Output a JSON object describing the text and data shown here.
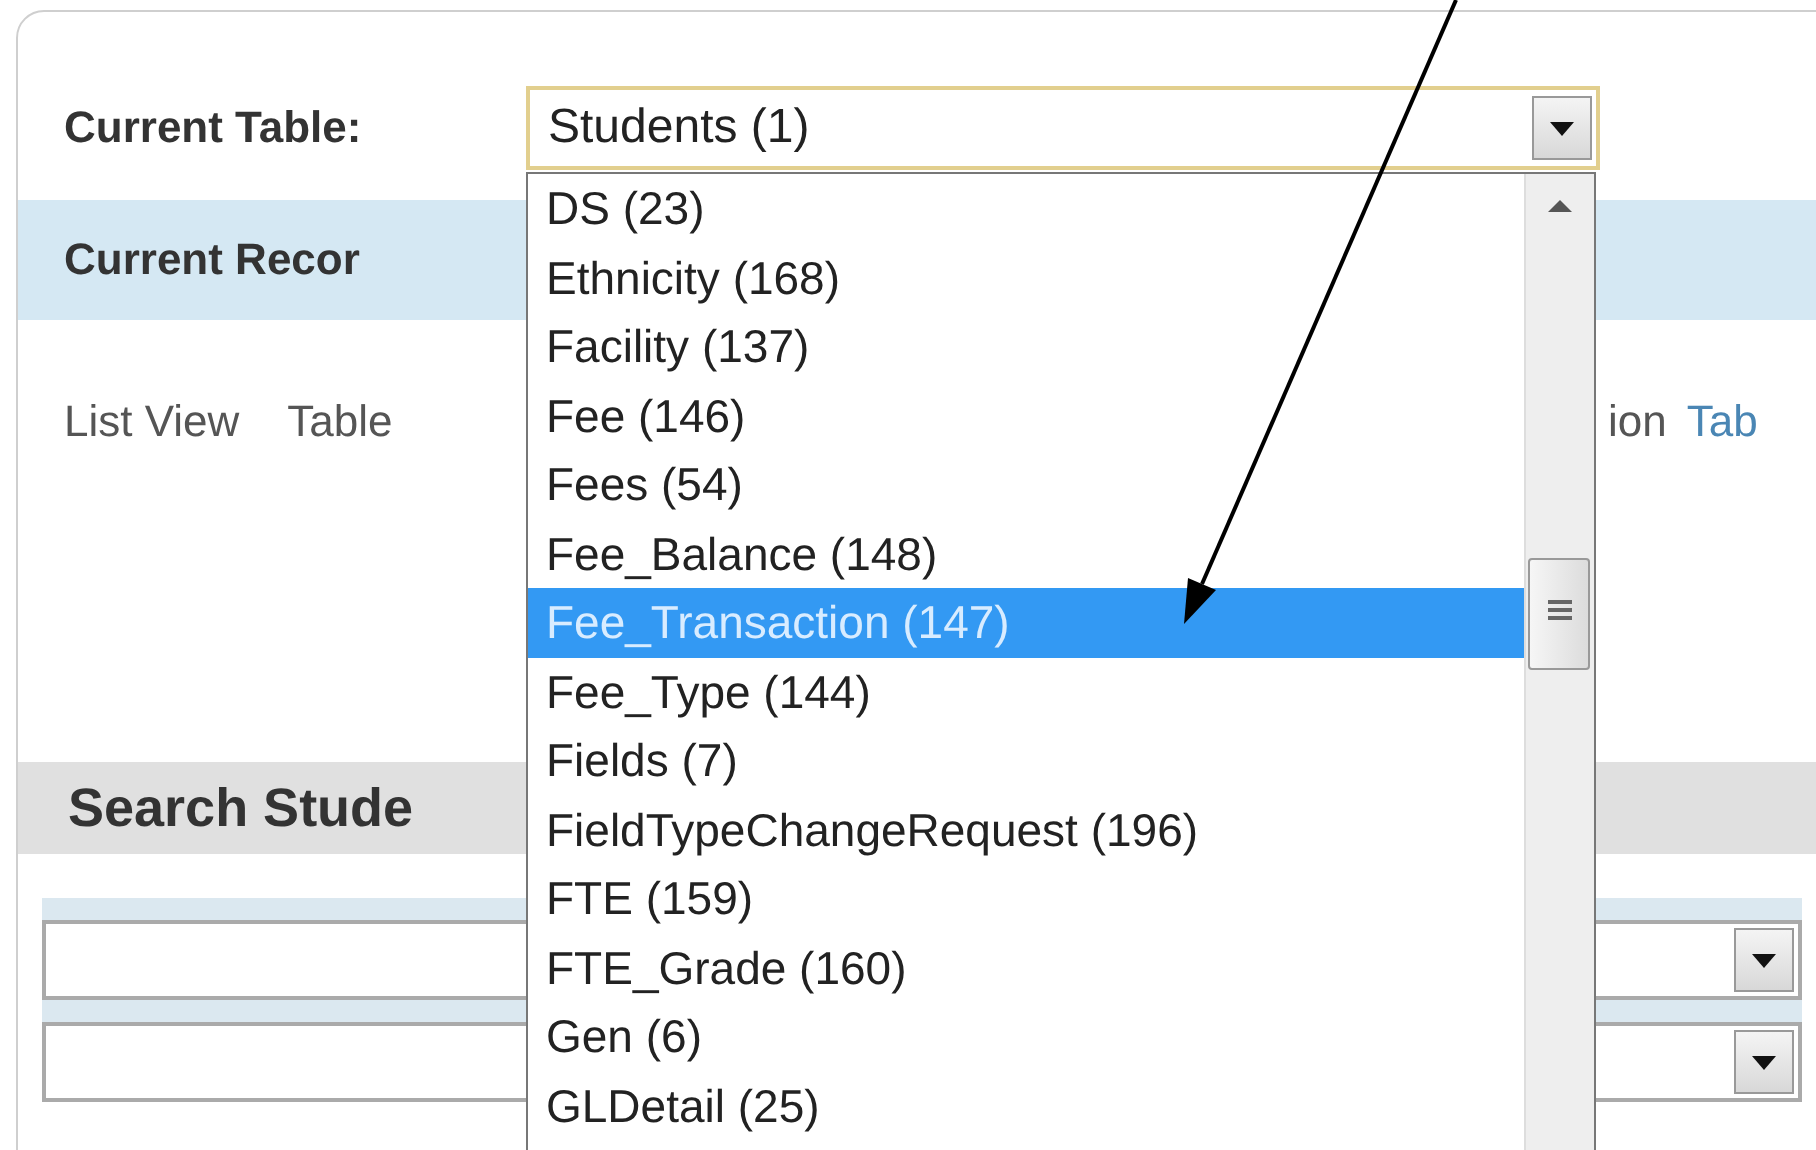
{
  "current_table": {
    "label": "Current Table:",
    "value": "Students (1)",
    "options": [
      {
        "label": "DS (23)",
        "selected": false
      },
      {
        "label": "Ethnicity (168)",
        "selected": false
      },
      {
        "label": "Facility (137)",
        "selected": false
      },
      {
        "label": "Fee (146)",
        "selected": false
      },
      {
        "label": "Fees (54)",
        "selected": false
      },
      {
        "label": "Fee_Balance (148)",
        "selected": false
      },
      {
        "label": "Fee_Transaction (147)",
        "selected": true
      },
      {
        "label": "Fee_Type (144)",
        "selected": false
      },
      {
        "label": "Fields (7)",
        "selected": false
      },
      {
        "label": "FieldTypeChangeRequest (196)",
        "selected": false
      },
      {
        "label": "FTE (159)",
        "selected": false
      },
      {
        "label": "FTE_Grade (160)",
        "selected": false
      },
      {
        "label": "Gen (6)",
        "selected": false
      },
      {
        "label": "GLDetail (25)",
        "selected": false
      }
    ]
  },
  "current_record": {
    "title": "Current Recor"
  },
  "views": {
    "left": [
      "List View",
      "Table"
    ],
    "right_text": "ion",
    "right_link": "Tab"
  },
  "search": {
    "title": "Search Stude"
  }
}
